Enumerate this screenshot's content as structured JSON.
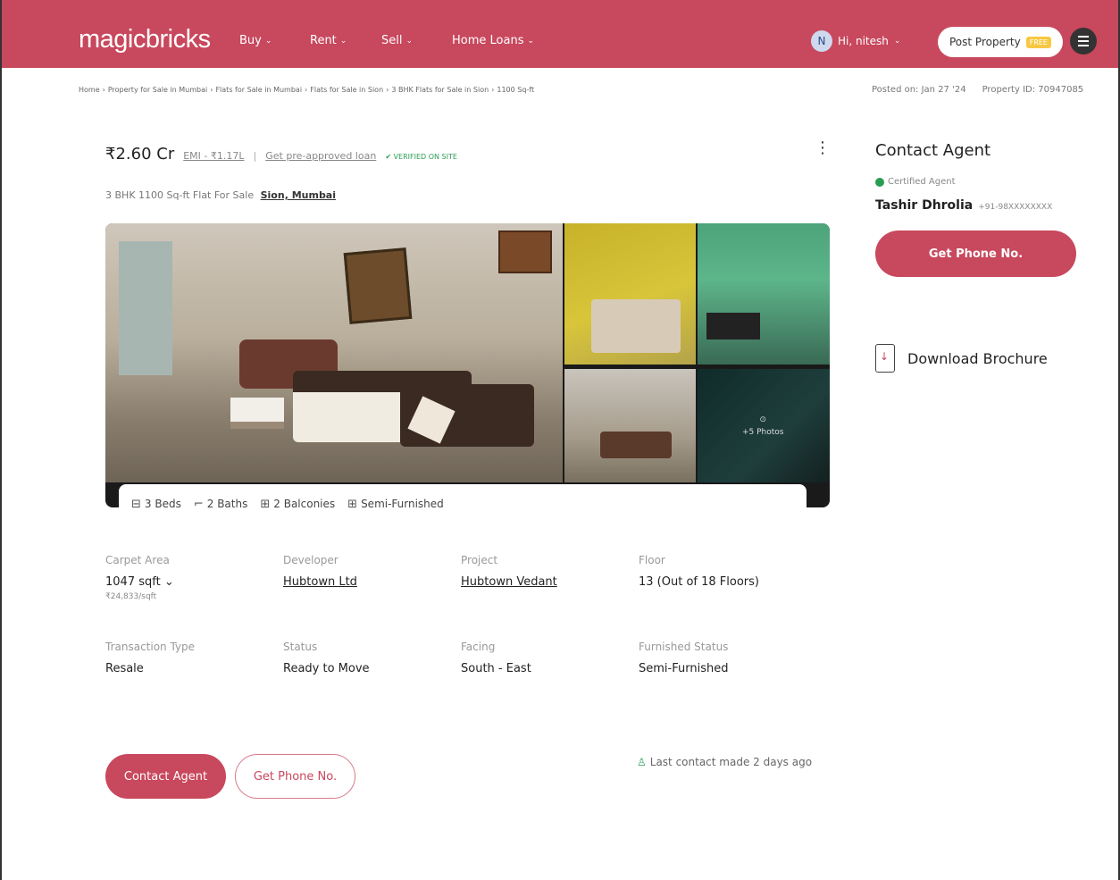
{
  "nav": {
    "logo": "magicbricks",
    "menu": [
      {
        "label": "Buy",
        "chev": "⌄"
      },
      {
        "label": "Rent",
        "chev": "⌄"
      },
      {
        "label": "Sell",
        "chev": "⌄"
      },
      {
        "label": "Home Loans",
        "chev": "⌄"
      }
    ],
    "user_initial": "N",
    "user_greeting": "Hi, nitesh",
    "user_chev": "⌄",
    "post_property": "Post Property",
    "free_tag": "FREE"
  },
  "breadcrumb": [
    "Home",
    "Property for Sale in Mumbai",
    "Flats for Sale in Mumbai",
    "Flats for Sale in Sion",
    "3 BHK Flats for Sale in Sion",
    "1100 Sq-ft"
  ],
  "breadcrumb_sep": "›",
  "posted_on": "Posted on: Jan 27 '24",
  "property_id": "Property ID: 70947085",
  "listing": {
    "price": "₹2.60 Cr",
    "emi": "EMI - ₹1.17L",
    "separator": "|",
    "preapproved": "Get pre-approved loan",
    "verified": "✔ VERIFIED ON SITE",
    "subtitle": "3 BHK 1100 Sq-ft Flat For Sale",
    "location": "Sion, Mumbai",
    "more_photos": "+5 Photos",
    "camera_icon": "⊙",
    "kebab": "⋮"
  },
  "features": [
    {
      "icon": "⊟",
      "label": "3 Beds"
    },
    {
      "icon": "⌐",
      "label": "2 Baths"
    },
    {
      "icon": "⊞",
      "label": "2 Balconies"
    },
    {
      "icon": "⊞",
      "label": "Semi-Furnished"
    }
  ],
  "details": {
    "row1": [
      {
        "label": "Carpet Area",
        "value": "1047 sqft ⌄",
        "sub": "₹24,833/sqft"
      },
      {
        "label": "Developer",
        "value": "Hubtown Ltd",
        "link": true
      },
      {
        "label": "Project",
        "value": "Hubtown Vedant",
        "link": true
      },
      {
        "label": "Floor",
        "value": "13 (Out of 18 Floors)"
      }
    ],
    "row2": [
      {
        "label": "Transaction Type",
        "value": "Resale"
      },
      {
        "label": "Status",
        "value": "Ready to Move"
      },
      {
        "label": "Facing",
        "value": "South - East"
      },
      {
        "label": "Furnished Status",
        "value": "Semi-Furnished"
      }
    ]
  },
  "actions": {
    "contact_agent": "Contact Agent",
    "get_phone": "Get Phone No.",
    "last_contact": "Last contact made 2 days ago",
    "last_contact_icon": "♙"
  },
  "agent": {
    "title": "Contact Agent",
    "certified": "Certified Agent",
    "name": "Tashir Dhrolia",
    "phone": "+91-98XXXXXXXX",
    "button": "Get Phone No.",
    "brochure": "Download Brochure"
  }
}
